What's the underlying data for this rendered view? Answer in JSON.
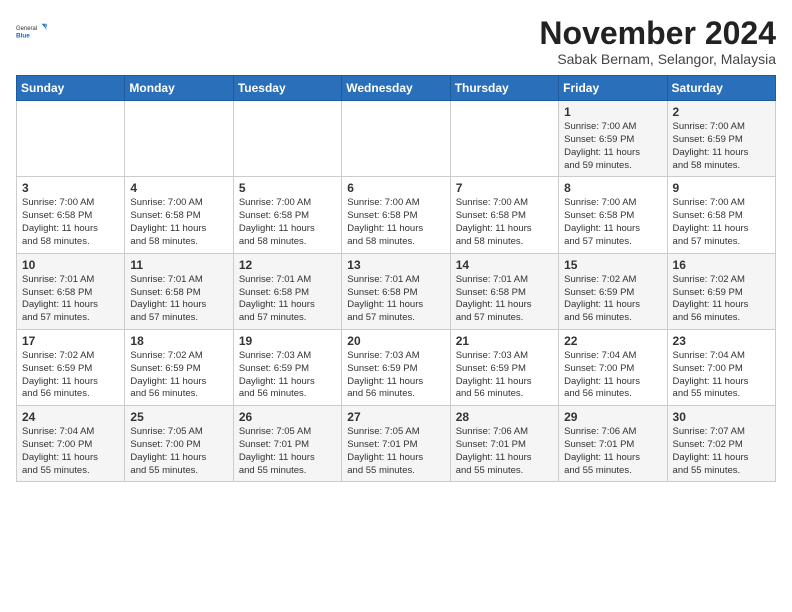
{
  "logo": {
    "general": "General",
    "blue": "Blue"
  },
  "header": {
    "month": "November 2024",
    "location": "Sabak Bernam, Selangor, Malaysia"
  },
  "days_of_week": [
    "Sunday",
    "Monday",
    "Tuesday",
    "Wednesday",
    "Thursday",
    "Friday",
    "Saturday"
  ],
  "weeks": [
    [
      {
        "day": "",
        "info": ""
      },
      {
        "day": "",
        "info": ""
      },
      {
        "day": "",
        "info": ""
      },
      {
        "day": "",
        "info": ""
      },
      {
        "day": "",
        "info": ""
      },
      {
        "day": "1",
        "info": "Sunrise: 7:00 AM\nSunset: 6:59 PM\nDaylight: 11 hours\nand 59 minutes."
      },
      {
        "day": "2",
        "info": "Sunrise: 7:00 AM\nSunset: 6:59 PM\nDaylight: 11 hours\nand 58 minutes."
      }
    ],
    [
      {
        "day": "3",
        "info": "Sunrise: 7:00 AM\nSunset: 6:58 PM\nDaylight: 11 hours\nand 58 minutes."
      },
      {
        "day": "4",
        "info": "Sunrise: 7:00 AM\nSunset: 6:58 PM\nDaylight: 11 hours\nand 58 minutes."
      },
      {
        "day": "5",
        "info": "Sunrise: 7:00 AM\nSunset: 6:58 PM\nDaylight: 11 hours\nand 58 minutes."
      },
      {
        "day": "6",
        "info": "Sunrise: 7:00 AM\nSunset: 6:58 PM\nDaylight: 11 hours\nand 58 minutes."
      },
      {
        "day": "7",
        "info": "Sunrise: 7:00 AM\nSunset: 6:58 PM\nDaylight: 11 hours\nand 58 minutes."
      },
      {
        "day": "8",
        "info": "Sunrise: 7:00 AM\nSunset: 6:58 PM\nDaylight: 11 hours\nand 57 minutes."
      },
      {
        "day": "9",
        "info": "Sunrise: 7:00 AM\nSunset: 6:58 PM\nDaylight: 11 hours\nand 57 minutes."
      }
    ],
    [
      {
        "day": "10",
        "info": "Sunrise: 7:01 AM\nSunset: 6:58 PM\nDaylight: 11 hours\nand 57 minutes."
      },
      {
        "day": "11",
        "info": "Sunrise: 7:01 AM\nSunset: 6:58 PM\nDaylight: 11 hours\nand 57 minutes."
      },
      {
        "day": "12",
        "info": "Sunrise: 7:01 AM\nSunset: 6:58 PM\nDaylight: 11 hours\nand 57 minutes."
      },
      {
        "day": "13",
        "info": "Sunrise: 7:01 AM\nSunset: 6:58 PM\nDaylight: 11 hours\nand 57 minutes."
      },
      {
        "day": "14",
        "info": "Sunrise: 7:01 AM\nSunset: 6:58 PM\nDaylight: 11 hours\nand 57 minutes."
      },
      {
        "day": "15",
        "info": "Sunrise: 7:02 AM\nSunset: 6:59 PM\nDaylight: 11 hours\nand 56 minutes."
      },
      {
        "day": "16",
        "info": "Sunrise: 7:02 AM\nSunset: 6:59 PM\nDaylight: 11 hours\nand 56 minutes."
      }
    ],
    [
      {
        "day": "17",
        "info": "Sunrise: 7:02 AM\nSunset: 6:59 PM\nDaylight: 11 hours\nand 56 minutes."
      },
      {
        "day": "18",
        "info": "Sunrise: 7:02 AM\nSunset: 6:59 PM\nDaylight: 11 hours\nand 56 minutes."
      },
      {
        "day": "19",
        "info": "Sunrise: 7:03 AM\nSunset: 6:59 PM\nDaylight: 11 hours\nand 56 minutes."
      },
      {
        "day": "20",
        "info": "Sunrise: 7:03 AM\nSunset: 6:59 PM\nDaylight: 11 hours\nand 56 minutes."
      },
      {
        "day": "21",
        "info": "Sunrise: 7:03 AM\nSunset: 6:59 PM\nDaylight: 11 hours\nand 56 minutes."
      },
      {
        "day": "22",
        "info": "Sunrise: 7:04 AM\nSunset: 7:00 PM\nDaylight: 11 hours\nand 56 minutes."
      },
      {
        "day": "23",
        "info": "Sunrise: 7:04 AM\nSunset: 7:00 PM\nDaylight: 11 hours\nand 55 minutes."
      }
    ],
    [
      {
        "day": "24",
        "info": "Sunrise: 7:04 AM\nSunset: 7:00 PM\nDaylight: 11 hours\nand 55 minutes."
      },
      {
        "day": "25",
        "info": "Sunrise: 7:05 AM\nSunset: 7:00 PM\nDaylight: 11 hours\nand 55 minutes."
      },
      {
        "day": "26",
        "info": "Sunrise: 7:05 AM\nSunset: 7:01 PM\nDaylight: 11 hours\nand 55 minutes."
      },
      {
        "day": "27",
        "info": "Sunrise: 7:05 AM\nSunset: 7:01 PM\nDaylight: 11 hours\nand 55 minutes."
      },
      {
        "day": "28",
        "info": "Sunrise: 7:06 AM\nSunset: 7:01 PM\nDaylight: 11 hours\nand 55 minutes."
      },
      {
        "day": "29",
        "info": "Sunrise: 7:06 AM\nSunset: 7:01 PM\nDaylight: 11 hours\nand 55 minutes."
      },
      {
        "day": "30",
        "info": "Sunrise: 7:07 AM\nSunset: 7:02 PM\nDaylight: 11 hours\nand 55 minutes."
      }
    ]
  ]
}
